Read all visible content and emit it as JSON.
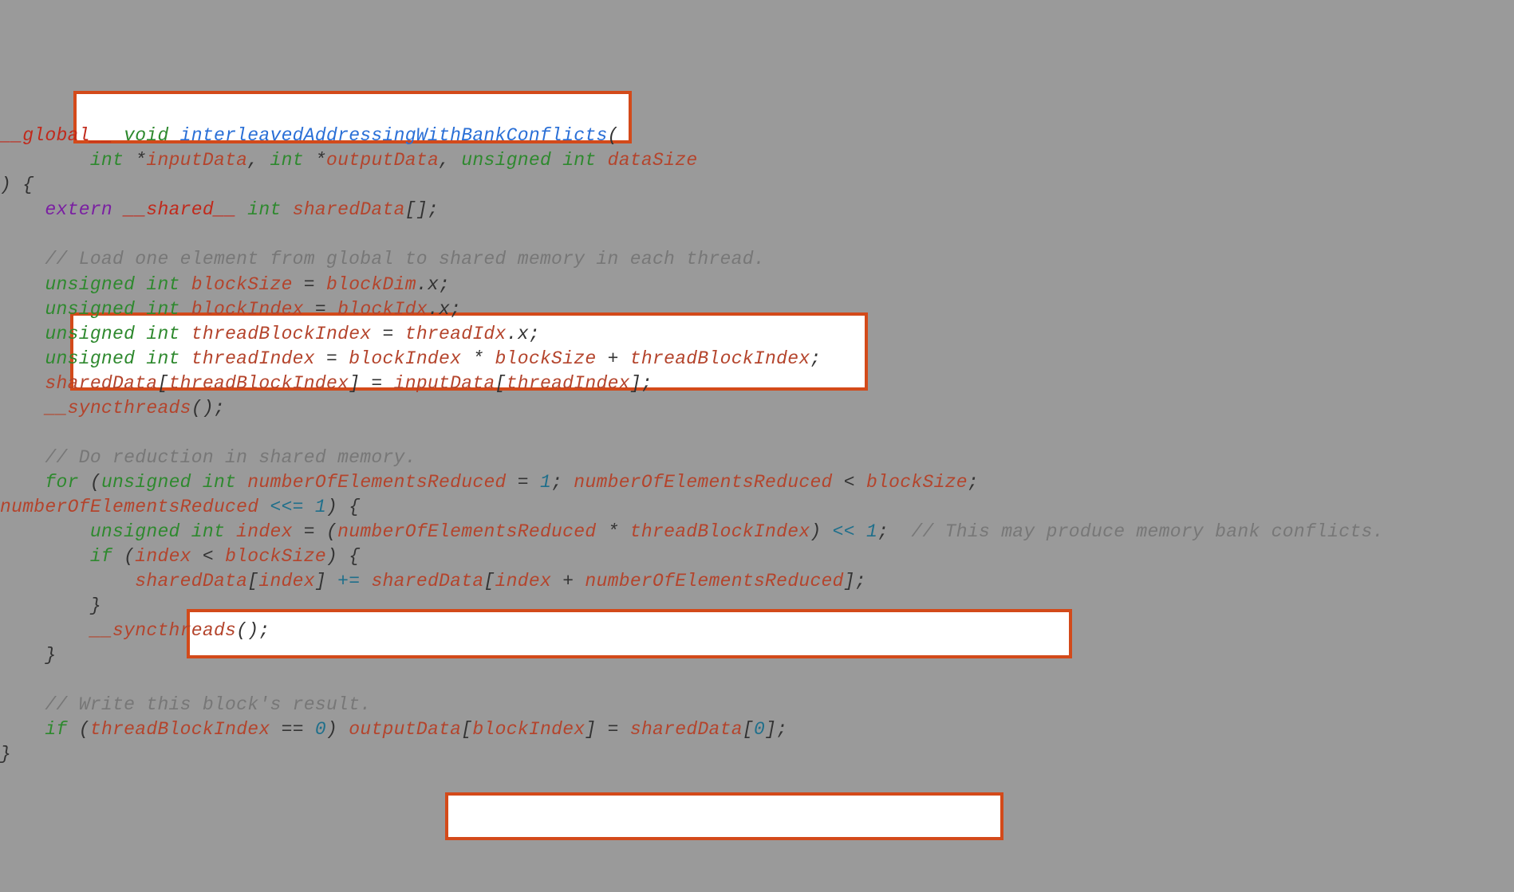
{
  "code": {
    "l1": {
      "global": "__global__",
      "void": " void ",
      "fn": "interleavedAddressingWithBankConflicts",
      "open": "("
    },
    "l2": {
      "indent": "        ",
      "type1": "int ",
      "star1": "*",
      "v1": "inputData",
      "sep1": ", ",
      "type2": "int ",
      "star2": "*",
      "v2": "outputData",
      "sep2": ", ",
      "type3": "unsigned int ",
      "v3": "dataSize"
    },
    "l3": {
      "txt": ") {"
    },
    "l4": {
      "indent": "    ",
      "extern": "extern",
      "sp1": " ",
      "shared": "__shared__",
      "sp2": " ",
      "type": "int ",
      "var": "sharedData",
      "brk": "[];"
    },
    "l6": {
      "indent": "    ",
      "cmt": "// Load one element from global to shared memory in each thread."
    },
    "l7": {
      "indent": "    ",
      "type": "unsigned int ",
      "var": "blockSize",
      "eq": " = ",
      "rhs1": "blockDim",
      "dot": ".x;"
    },
    "l8": {
      "indent": "    ",
      "type": "unsigned int ",
      "var": "blockIndex",
      "eq": " = ",
      "rhs1": "blockIdx",
      "dot": ".x;"
    },
    "l9": {
      "indent": "    ",
      "type": "unsigned int ",
      "var": "threadBlockIndex",
      "eq": " = ",
      "rhs1": "threadIdx",
      "dot": ".x;"
    },
    "l10": {
      "indent": "    ",
      "type": "unsigned int ",
      "var": "threadIndex",
      "eq": " = ",
      "a": "blockIndex",
      "op1": " * ",
      "b": "blockSize",
      "op2": " + ",
      "c": "threadBlockIndex",
      "semi": ";"
    },
    "l11": {
      "indent": "    ",
      "a": "sharedData",
      "br1": "[",
      "b": "threadBlockIndex",
      "br2": "] = ",
      "c": "inputData",
      "br3": "[",
      "d": "threadIndex",
      "br4": "];"
    },
    "l12": {
      "indent": "    ",
      "fn": "__syncthreads",
      "call": "();"
    },
    "l14": {
      "indent": "    ",
      "cmt": "// Do reduction in shared memory."
    },
    "l15": {
      "indent": "    ",
      "for": "for",
      "open": " (",
      "type": "unsigned int ",
      "var": "numberOfElementsReduced",
      "eq": " = ",
      "one": "1",
      "semi1": "; ",
      "var2": "numberOfElementsReduced",
      "lt": " < ",
      "bs": "blockSize",
      "semi2": "; "
    },
    "l16": {
      "a": "numberOfElementsReduced",
      "op": " <<= ",
      "one": "1",
      "close": ") {"
    },
    "l17": {
      "indent": "        ",
      "type": "unsigned int ",
      "var": "index",
      "eq": " = (",
      "a": "numberOfElementsReduced",
      "op1": " * ",
      "b": "threadBlockIndex",
      "close": ") ",
      "shift": "<< ",
      "one": "1",
      "semi": ";  ",
      "cmt": "// This may produce memory bank conflicts."
    },
    "l18": {
      "indent": "        ",
      "if": "if",
      "open": " (",
      "a": "index",
      "lt": " < ",
      "b": "blockSize",
      "close": ") {"
    },
    "l19": {
      "indent": "            ",
      "a": "sharedData",
      "br1": "[",
      "b": "index",
      "br2": "] ",
      "op": "+=",
      "sp": " ",
      "c": "sharedData",
      "br3": "[",
      "d": "index",
      "plus": " + ",
      "e": "numberOfElementsReduced",
      "br4": "];"
    },
    "l20": {
      "indent": "        ",
      "txt": "}"
    },
    "l21": {
      "indent": "        ",
      "fn": "__syncthreads",
      "call": "();"
    },
    "l22": {
      "indent": "    ",
      "txt": "}"
    },
    "l24": {
      "indent": "    ",
      "cmt": "// Write this block's result."
    },
    "l25": {
      "indent": "    ",
      "if": "if",
      "open": " (",
      "a": "threadBlockIndex",
      "eqeq": " == ",
      "zero": "0",
      "close": ") ",
      "b": "outputData",
      "br1": "[",
      "c": "blockIndex",
      "br2": "] = ",
      "d": "sharedData",
      "br3": "[",
      "zero2": "0",
      "br4": "];"
    },
    "l26": {
      "txt": "}"
    }
  }
}
